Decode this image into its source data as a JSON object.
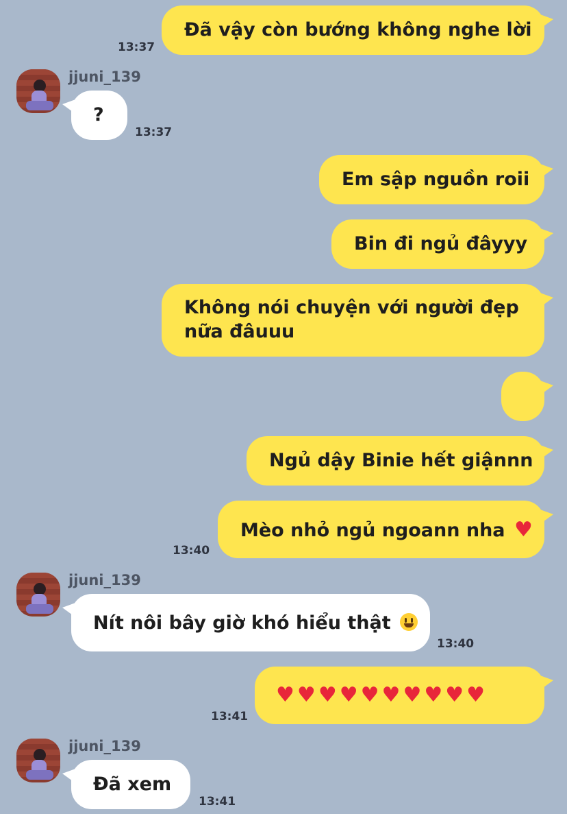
{
  "contact": {
    "name": "jjuni_139"
  },
  "messages": [
    {
      "text": "Đã vậy còn bướng không nghe lời",
      "time": "13:37"
    },
    {
      "text": "?",
      "time": "13:37"
    },
    {
      "text": "Em sập nguồn roii"
    },
    {
      "text": "Bin đi ngủ đâyyy"
    },
    {
      "line1": "Không nói chuyện với người đẹp",
      "line2": "nữa đâuuu"
    },
    {
      "text": ""
    },
    {
      "text": "Ngủ dậy Binie hết giậnnn"
    },
    {
      "text": "Mèo nhỏ ngủ ngoann nha",
      "emoji": "red-heart",
      "time": "13:40"
    },
    {
      "text": "Nít nôi bây giờ khó hiểu thật",
      "emoji": "grinning-face",
      "time": "13:40"
    },
    {
      "emoji": "red-heart",
      "count": 10,
      "time": "13:41"
    },
    {
      "text": "Đã xem",
      "time": "13:41"
    }
  ],
  "colors": {
    "background": "#a9b8cb",
    "my_bubble": "#fee54f",
    "their_bubble": "#ffffff",
    "heart": "#e8263a"
  }
}
